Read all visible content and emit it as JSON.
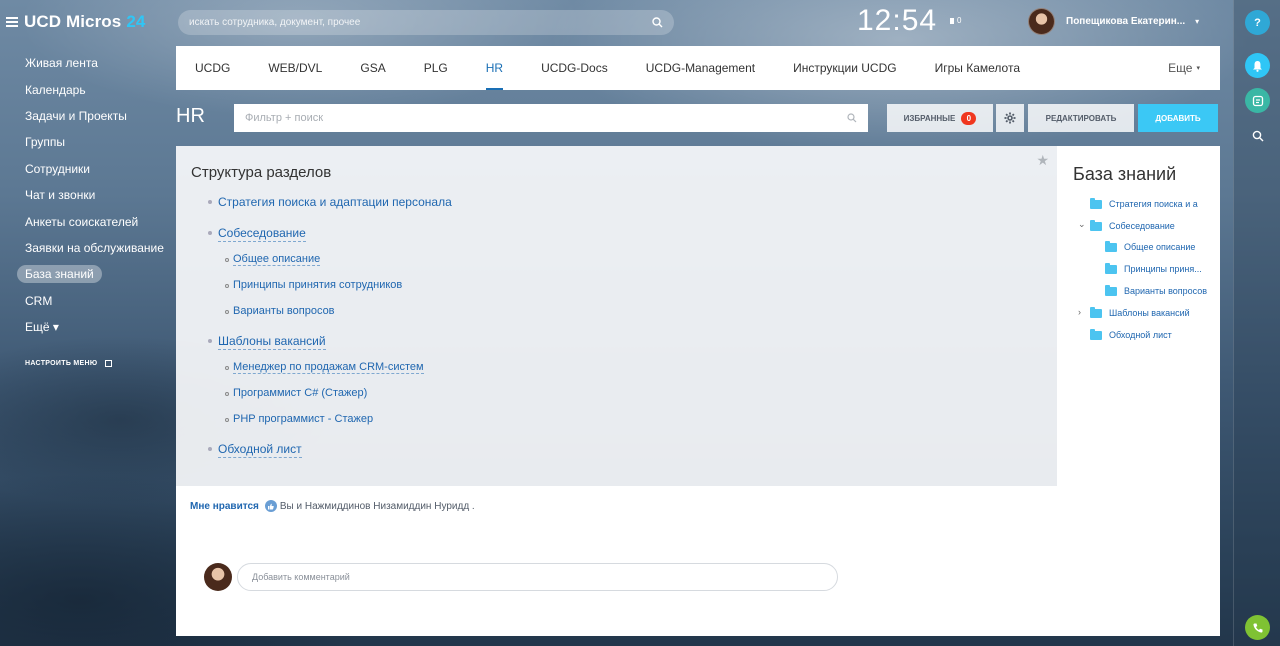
{
  "app": {
    "logo_text": "UCD Micros",
    "logo_num": "24"
  },
  "sidebar": {
    "items": [
      {
        "label": "Живая лента"
      },
      {
        "label": "Календарь"
      },
      {
        "label": "Задачи и Проекты"
      },
      {
        "label": "Группы"
      },
      {
        "label": "Сотрудники"
      },
      {
        "label": "Чат и звонки"
      },
      {
        "label": "Анкеты соискателей"
      },
      {
        "label": "Заявки на обслуживание"
      },
      {
        "label": "База знаний"
      },
      {
        "label": "CRM"
      },
      {
        "label": "Ещё ▾"
      }
    ],
    "settings_label": "НАСТРОИТЬ МЕНЮ"
  },
  "header": {
    "search_placeholder": "искать сотрудника, документ, прочее",
    "clock": "12:54",
    "flag_count": "0",
    "user_name": "Попещикова Екатерин..."
  },
  "tabs": {
    "items": [
      {
        "label": "UCDG"
      },
      {
        "label": "WEB/DVL"
      },
      {
        "label": "GSA"
      },
      {
        "label": "PLG"
      },
      {
        "label": "HR"
      },
      {
        "label": "UCDG-Docs"
      },
      {
        "label": "UCDG-Management"
      },
      {
        "label": "Инструкции UCDG"
      },
      {
        "label": "Игры Камелота"
      }
    ],
    "more_label": "Еще"
  },
  "toolbar": {
    "page_title": "HR",
    "filter_placeholder": "Фильтр + поиск",
    "fav_label": "ИЗБРАННЫЕ",
    "fav_count": "0",
    "edit_label": "РЕДАКТИРОВАТЬ",
    "add_label": "ДОБАВИТЬ"
  },
  "content": {
    "title": "Структура разделов",
    "tree": {
      "s1": "Стратегия поиска и адаптации персонала",
      "s2": "Собеседование",
      "s2_1": "Общее описание",
      "s2_2": "Принципы принятия сотрудников",
      "s2_3": "Варианты вопросов",
      "s3": "Шаблоны вакансий",
      "s3_1": "Менеджер по продажам CRM-систем",
      "s3_2": "Программист C# (Стажер)",
      "s3_3": "PHP программист - Стажер",
      "s4": "Обходной лист"
    },
    "like_label": "Мне нравится",
    "like_names": "Вы и Нажмиддинов Низамиддин Нуридд .",
    "comment_placeholder": "Добавить комментарий"
  },
  "knowledge_base": {
    "title": "База знаний",
    "items": [
      {
        "label": "Стратегия поиска и а"
      },
      {
        "label": "Собеседование"
      },
      {
        "label": "Общее описание"
      },
      {
        "label": "Принципы приня..."
      },
      {
        "label": "Варианты вопросов"
      },
      {
        "label": "Шаблоны вакансий"
      },
      {
        "label": "Обходной лист"
      }
    ]
  },
  "colors": {
    "accent": "#3bc8f5",
    "link": "#2067b0",
    "badge": "#f0371f"
  }
}
